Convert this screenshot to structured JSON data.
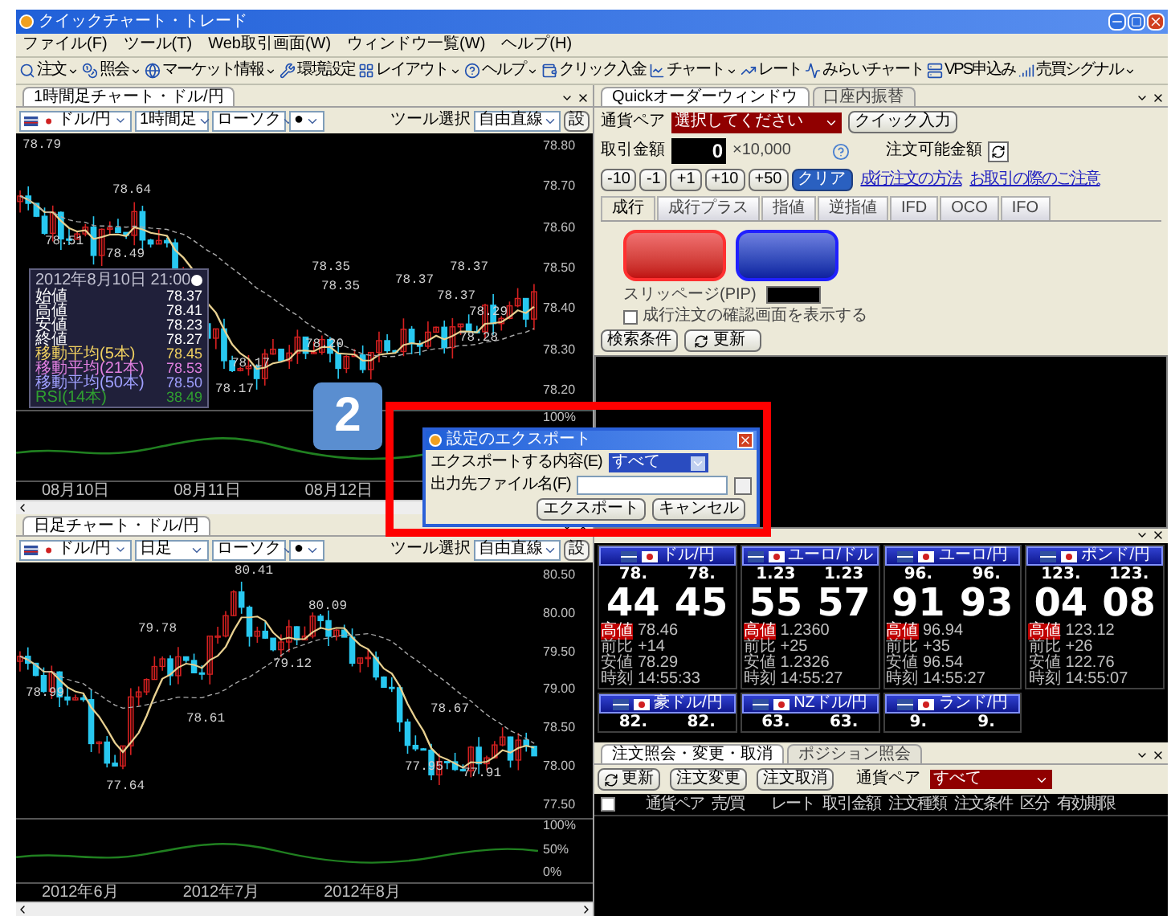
{
  "window": {
    "title": "クイックチャート・トレード"
  },
  "menu": [
    "ファイル(F)",
    "ツール(T)",
    "Web取引画面(W)",
    "ウィンドウ一覧(W)",
    "ヘルプ(H)"
  ],
  "toolbar": [
    {
      "label": "注文",
      "dropdown": true
    },
    {
      "label": "照会",
      "dropdown": true
    },
    {
      "label": "マーケット情報",
      "dropdown": true
    },
    {
      "label": "環境設定",
      "dropdown": false
    },
    {
      "label": "レイアウト",
      "dropdown": true
    },
    {
      "label": "ヘルプ",
      "dropdown": true
    },
    {
      "label": "クリック入金",
      "dropdown": false
    },
    {
      "label": "チャート",
      "dropdown": true
    },
    {
      "label": "レート",
      "dropdown": false
    },
    {
      "label": "みらいチャート",
      "dropdown": false
    },
    {
      "label": "VPS申込み",
      "dropdown": false
    },
    {
      "label": "売買シグナル",
      "dropdown": true
    }
  ],
  "charts": [
    {
      "tab": "1時間足チャート・ドル/円",
      "pair": "ドル/円",
      "period": "1時間足",
      "style": "ローソク",
      "marker": "●",
      "tool_label": "ツール選択",
      "tool": "自由直線",
      "settings": "設",
      "y_labels": [
        "78.80",
        "78.70",
        "78.60",
        "78.50",
        "78.40",
        "78.30",
        "78.20"
      ],
      "indicator_labels": [
        "100%"
      ],
      "x_labels": [
        "08月10日",
        "08月11日",
        "08月12日"
      ],
      "annotations": [
        "78.79",
        "78.64",
        "78.51",
        "78.49",
        "78.35",
        "78.35",
        "78.37",
        "78.37",
        "78.37",
        "78.29",
        "78.28",
        "78.20",
        "78.17",
        "78.17"
      ],
      "info_box": {
        "title": "2012年8月10日 21:00",
        "rows": [
          {
            "label": "始値",
            "value": "78.37",
            "color": "#ffffff"
          },
          {
            "label": "高値",
            "value": "78.41",
            "color": "#ffffff"
          },
          {
            "label": "安値",
            "value": "78.23",
            "color": "#ffffff"
          },
          {
            "label": "終値",
            "value": "78.27",
            "color": "#ffffff"
          },
          {
            "label": "移動平均(5本)",
            "value": "78.45",
            "color": "#f0d060"
          },
          {
            "label": "移動平均(21本)",
            "value": "78.53",
            "color": "#e080e0"
          },
          {
            "label": "移動平均(50本)",
            "value": "78.50",
            "color": "#a0a0ff"
          },
          {
            "label": "RSI(14本)",
            "value": "38.49",
            "color": "#30a030"
          }
        ]
      }
    },
    {
      "tab": "日足チャート・ドル/円",
      "pair": "ドル/円",
      "period": "日足",
      "style": "ローソク",
      "marker": "●",
      "tool_label": "ツール選択",
      "tool": "自由直線",
      "settings": "設",
      "y_labels": [
        "80.50",
        "80.00",
        "79.50",
        "79.00",
        "78.50",
        "78.00",
        "77.50"
      ],
      "indicator_labels": [
        "100%",
        "50%",
        "0%"
      ],
      "x_labels": [
        "2012年6月",
        "2012年7月",
        "2012年8月"
      ],
      "annotations": [
        "80.41",
        "80.09",
        "79.78",
        "79.12",
        "78.99",
        "78.61",
        "77.64",
        "78.67",
        "77.95",
        "77.91"
      ]
    }
  ],
  "quick_order": {
    "tabs": [
      {
        "label": "Quickオーダーウィンドウ",
        "selected": true
      },
      {
        "label": "口座内振替",
        "selected": false
      }
    ],
    "pair_label": "通貨ペア",
    "pair_value": "選択してください",
    "quick_input": "クイック入力",
    "amount_label": "取引金額",
    "amount": "0",
    "unit": "×10,000",
    "available_label": "注文可能金額",
    "steps": [
      {
        "label": "-10",
        "kind": "step"
      },
      {
        "label": "-1",
        "kind": "step"
      },
      {
        "label": "+1",
        "kind": "step"
      },
      {
        "label": "+10",
        "kind": "step"
      },
      {
        "label": "+50",
        "kind": "step"
      },
      {
        "label": "クリア",
        "kind": "clear"
      }
    ],
    "links": [
      "成行注文の方法",
      "お取引の際のご注意"
    ],
    "order_tabs": [
      {
        "label": "成行",
        "selected": true
      },
      {
        "label": "成行プラス",
        "selected": false
      },
      {
        "label": "指値",
        "selected": false
      },
      {
        "label": "逆指値",
        "selected": false
      },
      {
        "label": "IFD",
        "selected": false
      },
      {
        "label": "OCO",
        "selected": false
      },
      {
        "label": "IFO",
        "selected": false
      }
    ],
    "slippage_label": "スリッページ(PIP)",
    "confirm": {
      "label": "成行注文の確認画面を表示する",
      "checked": false
    },
    "search_button": "検索条件",
    "refresh_button": "更新"
  },
  "dialog": {
    "title": "設定のエクスポート",
    "content_label": "エクスポートする内容(E)",
    "content_value": "すべて",
    "file_label": "出力先ファイル名(F)",
    "buttons": [
      "エクスポート",
      "キャンセル"
    ]
  },
  "step_badge": "2",
  "rates": [
    {
      "kind": "full",
      "pair": "ドル/円",
      "bid_head": "78.",
      "bid_tail": "44",
      "ask_head": "78.",
      "ask_tail": "45",
      "high_label": "高値",
      "high": "78.46",
      "change_label": "前比",
      "change": "+14",
      "low_label": "安値",
      "low": "78.29",
      "time_label": "時刻",
      "time": "14:55:33"
    },
    {
      "kind": "full",
      "pair": "ユーロ/ドル",
      "bid_head": "1.23",
      "bid_tail": "55",
      "ask_head": "1.23",
      "ask_tail": "57",
      "high_label": "高値",
      "high": "1.2360",
      "change_label": "前比",
      "change": "+25",
      "low_label": "安値",
      "low": "1.2326",
      "time_label": "時刻",
      "time": "14:55:27"
    },
    {
      "kind": "full",
      "pair": "ユーロ/円",
      "bid_head": "96.",
      "bid_tail": "91",
      "ask_head": "96.",
      "ask_tail": "93",
      "high_label": "高値",
      "high": "96.94",
      "change_label": "前比",
      "change": "+35",
      "low_label": "安値",
      "low": "96.54",
      "time_label": "時刻",
      "time": "14:55:27"
    },
    {
      "kind": "full",
      "pair": "ポンド/円",
      "bid_head": "123.",
      "bid_tail": "04",
      "ask_head": "123.",
      "ask_tail": "08",
      "high_label": "高値",
      "high": "123.12",
      "change_label": "前比",
      "change": "+26",
      "low_label": "安値",
      "low": "122.76",
      "time_label": "時刻",
      "time": "14:55:07"
    },
    {
      "kind": "partial",
      "pair": "豪ドル/円",
      "bid_head": "82.",
      "ask_head": "82."
    },
    {
      "kind": "partial",
      "pair": "NZドル/円",
      "bid_head": "63.",
      "ask_head": "63."
    },
    {
      "kind": "partial",
      "pair": "ランド/円",
      "bid_head": "9.",
      "ask_head": "9."
    }
  ],
  "orders": {
    "tabs": [
      {
        "label": "注文照会・変更・取消",
        "selected": true
      },
      {
        "label": "ポジション照会",
        "selected": false
      }
    ],
    "refresh": "更新",
    "modify": "注文変更",
    "cancel": "注文取消",
    "pair_label": "通貨ペア",
    "pair_value": "すべて",
    "select_all": {
      "checked": false
    },
    "columns": [
      "通貨ペア",
      "売/買",
      "レート",
      "取引金額",
      "注文種類",
      "注文条件",
      "区分",
      "有効期限"
    ]
  }
}
